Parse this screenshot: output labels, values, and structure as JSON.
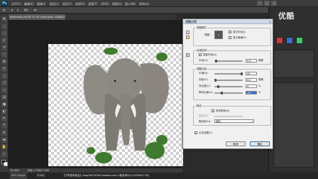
{
  "app": {
    "logo": "Ps",
    "menu": [
      "文件(F)",
      "编辑(E)",
      "图像(I)",
      "图层(L)",
      "类型(Y)",
      "选择(S)",
      "滤镜(T)",
      "3D(D)",
      "视图(V)",
      "窗口(W)",
      "帮助(H)"
    ],
    "window_controls": [
      "—",
      "□",
      "×"
    ]
  },
  "options_bar": {
    "tool_size": "30",
    "mode_labels": [
      "模式",
      "尖角"
    ]
  },
  "document": {
    "tab_label": "elephants.psd @ 79.1% (elephants, RGB/8) *",
    "zoom": "79.06%",
    "doc_info": "文档:1.19M/1.20M"
  },
  "bottom": {
    "tabs": [
      "Mini Bridge",
      "时间轴"
    ],
    "watermark": "【子学堂淘宝店】shop36474994.taobao.com 小程老师QQ:1209620743】"
  },
  "right_panel": {
    "brand": "优酷"
  },
  "dialog": {
    "title": "调整边缘",
    "view_mode": {
      "group": "视图模式",
      "view_label": "视图:",
      "show_radius": "显示半径(J)",
      "show_original": "显示原稿(P)"
    },
    "edge_detection": {
      "group": "边缘检测",
      "smart_radius": "智能半径(A)",
      "radius_label": "半径(U):",
      "radius_value": "0.5",
      "radius_unit": "像素"
    },
    "adjust_edge": {
      "group": "调整边缘",
      "smooth_label": "平滑(H):",
      "smooth_value": "45",
      "feather_label": "羽化(E):",
      "feather_value": "0.0",
      "feather_unit": "像素",
      "contrast_label": "对比度(C):",
      "contrast_value": "9",
      "contrast_unit": "%",
      "shift_label": "移动边缘(S):",
      "shift_value": "-52",
      "shift_unit": "%"
    },
    "output": {
      "group": "输出",
      "decontaminate": "净化颜色(D)",
      "amount_label": "数量(N):",
      "output_to_label": "输出到(O):",
      "output_to_value": "选区"
    },
    "remember": "记住设置(T)",
    "cancel": "取消",
    "ok": "确定"
  }
}
